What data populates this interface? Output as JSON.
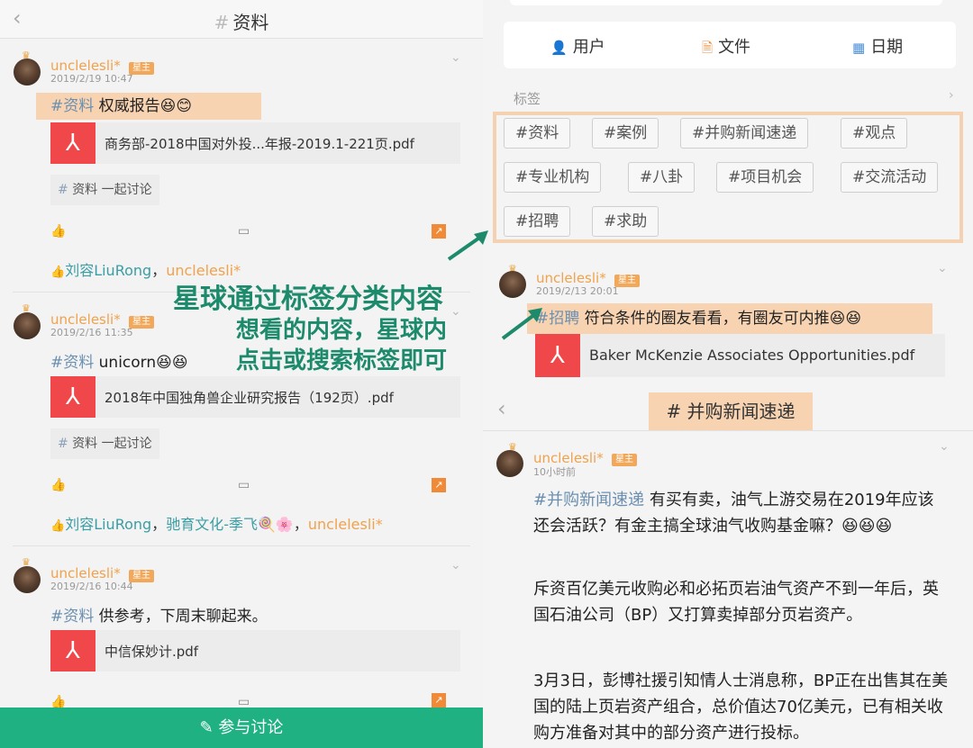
{
  "left": {
    "header": {
      "hash": "#",
      "title": "资料",
      "back": "‹"
    },
    "posts": [
      {
        "username": "unclelesli*",
        "badge": "星主",
        "date": "2019/2/19 10:47",
        "tag": "#资料",
        "text": " 权威报告😆😊",
        "file": "商务部-2018中国对外投...年报-2019.1-221页.pdf",
        "chip_hash": "#",
        "chip_label": " 资料 一起讨论",
        "likers": [
          {
            "name": "刘容LiuRong",
            "color": "g"
          },
          {
            "name": "unclelesli*",
            "color": "o"
          }
        ]
      },
      {
        "username": "unclelesli*",
        "badge": "星主",
        "date": "2019/2/16 11:35",
        "tag": "#资料",
        "text": " unicorn😆😆",
        "file": "2018年中国独角兽企业研究报告（192页）.pdf",
        "chip_hash": "#",
        "chip_label": " 资料 一起讨论",
        "likers": [
          {
            "name": "刘容LiuRong",
            "color": "g"
          },
          {
            "name": "驰育文化-季飞🍭🌸",
            "color": "g"
          },
          {
            "name": "unclelesli*",
            "color": "o"
          }
        ]
      },
      {
        "username": "unclelesli*",
        "badge": "星主",
        "date": "2019/2/16 10:44",
        "tag": "#资料",
        "text": " 供参考，下周末聊起来。",
        "file": "中信保妙计.pdf"
      }
    ],
    "join_button": "参与讨论",
    "join_icon": "✎"
  },
  "overlay": {
    "line1": "星球通过标签分类内容",
    "line2": "想看的内容，星球内",
    "line3": "点击或搜索标签即可"
  },
  "right": {
    "tabs": [
      {
        "icon": "user-icon",
        "label": "用户"
      },
      {
        "icon": "file-icon",
        "label": "文件"
      },
      {
        "icon": "calendar-icon",
        "label": "日期"
      }
    ],
    "tags_heading": "标签",
    "tags": [
      "#资料",
      "#案例",
      "#并购新闻速递",
      "#观点",
      "#专业机构",
      "#八卦",
      "#项目机会",
      "#交流活动",
      "#招聘",
      "#求助"
    ],
    "post": {
      "username": "unclelesli*",
      "badge": "星主",
      "date": "2019/2/13 20:01",
      "tag": "#招聘",
      "text": " 符合条件的圈友看看，有圈友可内推😆😆",
      "file": "Baker McKenzie Associates Opportunities.pdf"
    },
    "section_title": "# 并购新闻速递",
    "post2": {
      "username": "unclelesli*",
      "badge": "星主",
      "date": "10小时前",
      "tag": "#并购新闻速递",
      "para1": " 有买有卖，油气上游交易在2019年应该还会活跃？有金主搞全球油气收购基金嘛？😆😆😆",
      "para2": "斥资百亿美元收购必和必拓页岩油气资产不到一年后，英国石油公司（BP）又打算卖掉部分页岩资产。",
      "para3": "3月3日，彭博社援引知情人士消息称，BP正在出售其在美国的陆上页岩资产组合，总价值达70亿美元，已有相关收购方准备对其中的部分资产进行投标。"
    }
  }
}
